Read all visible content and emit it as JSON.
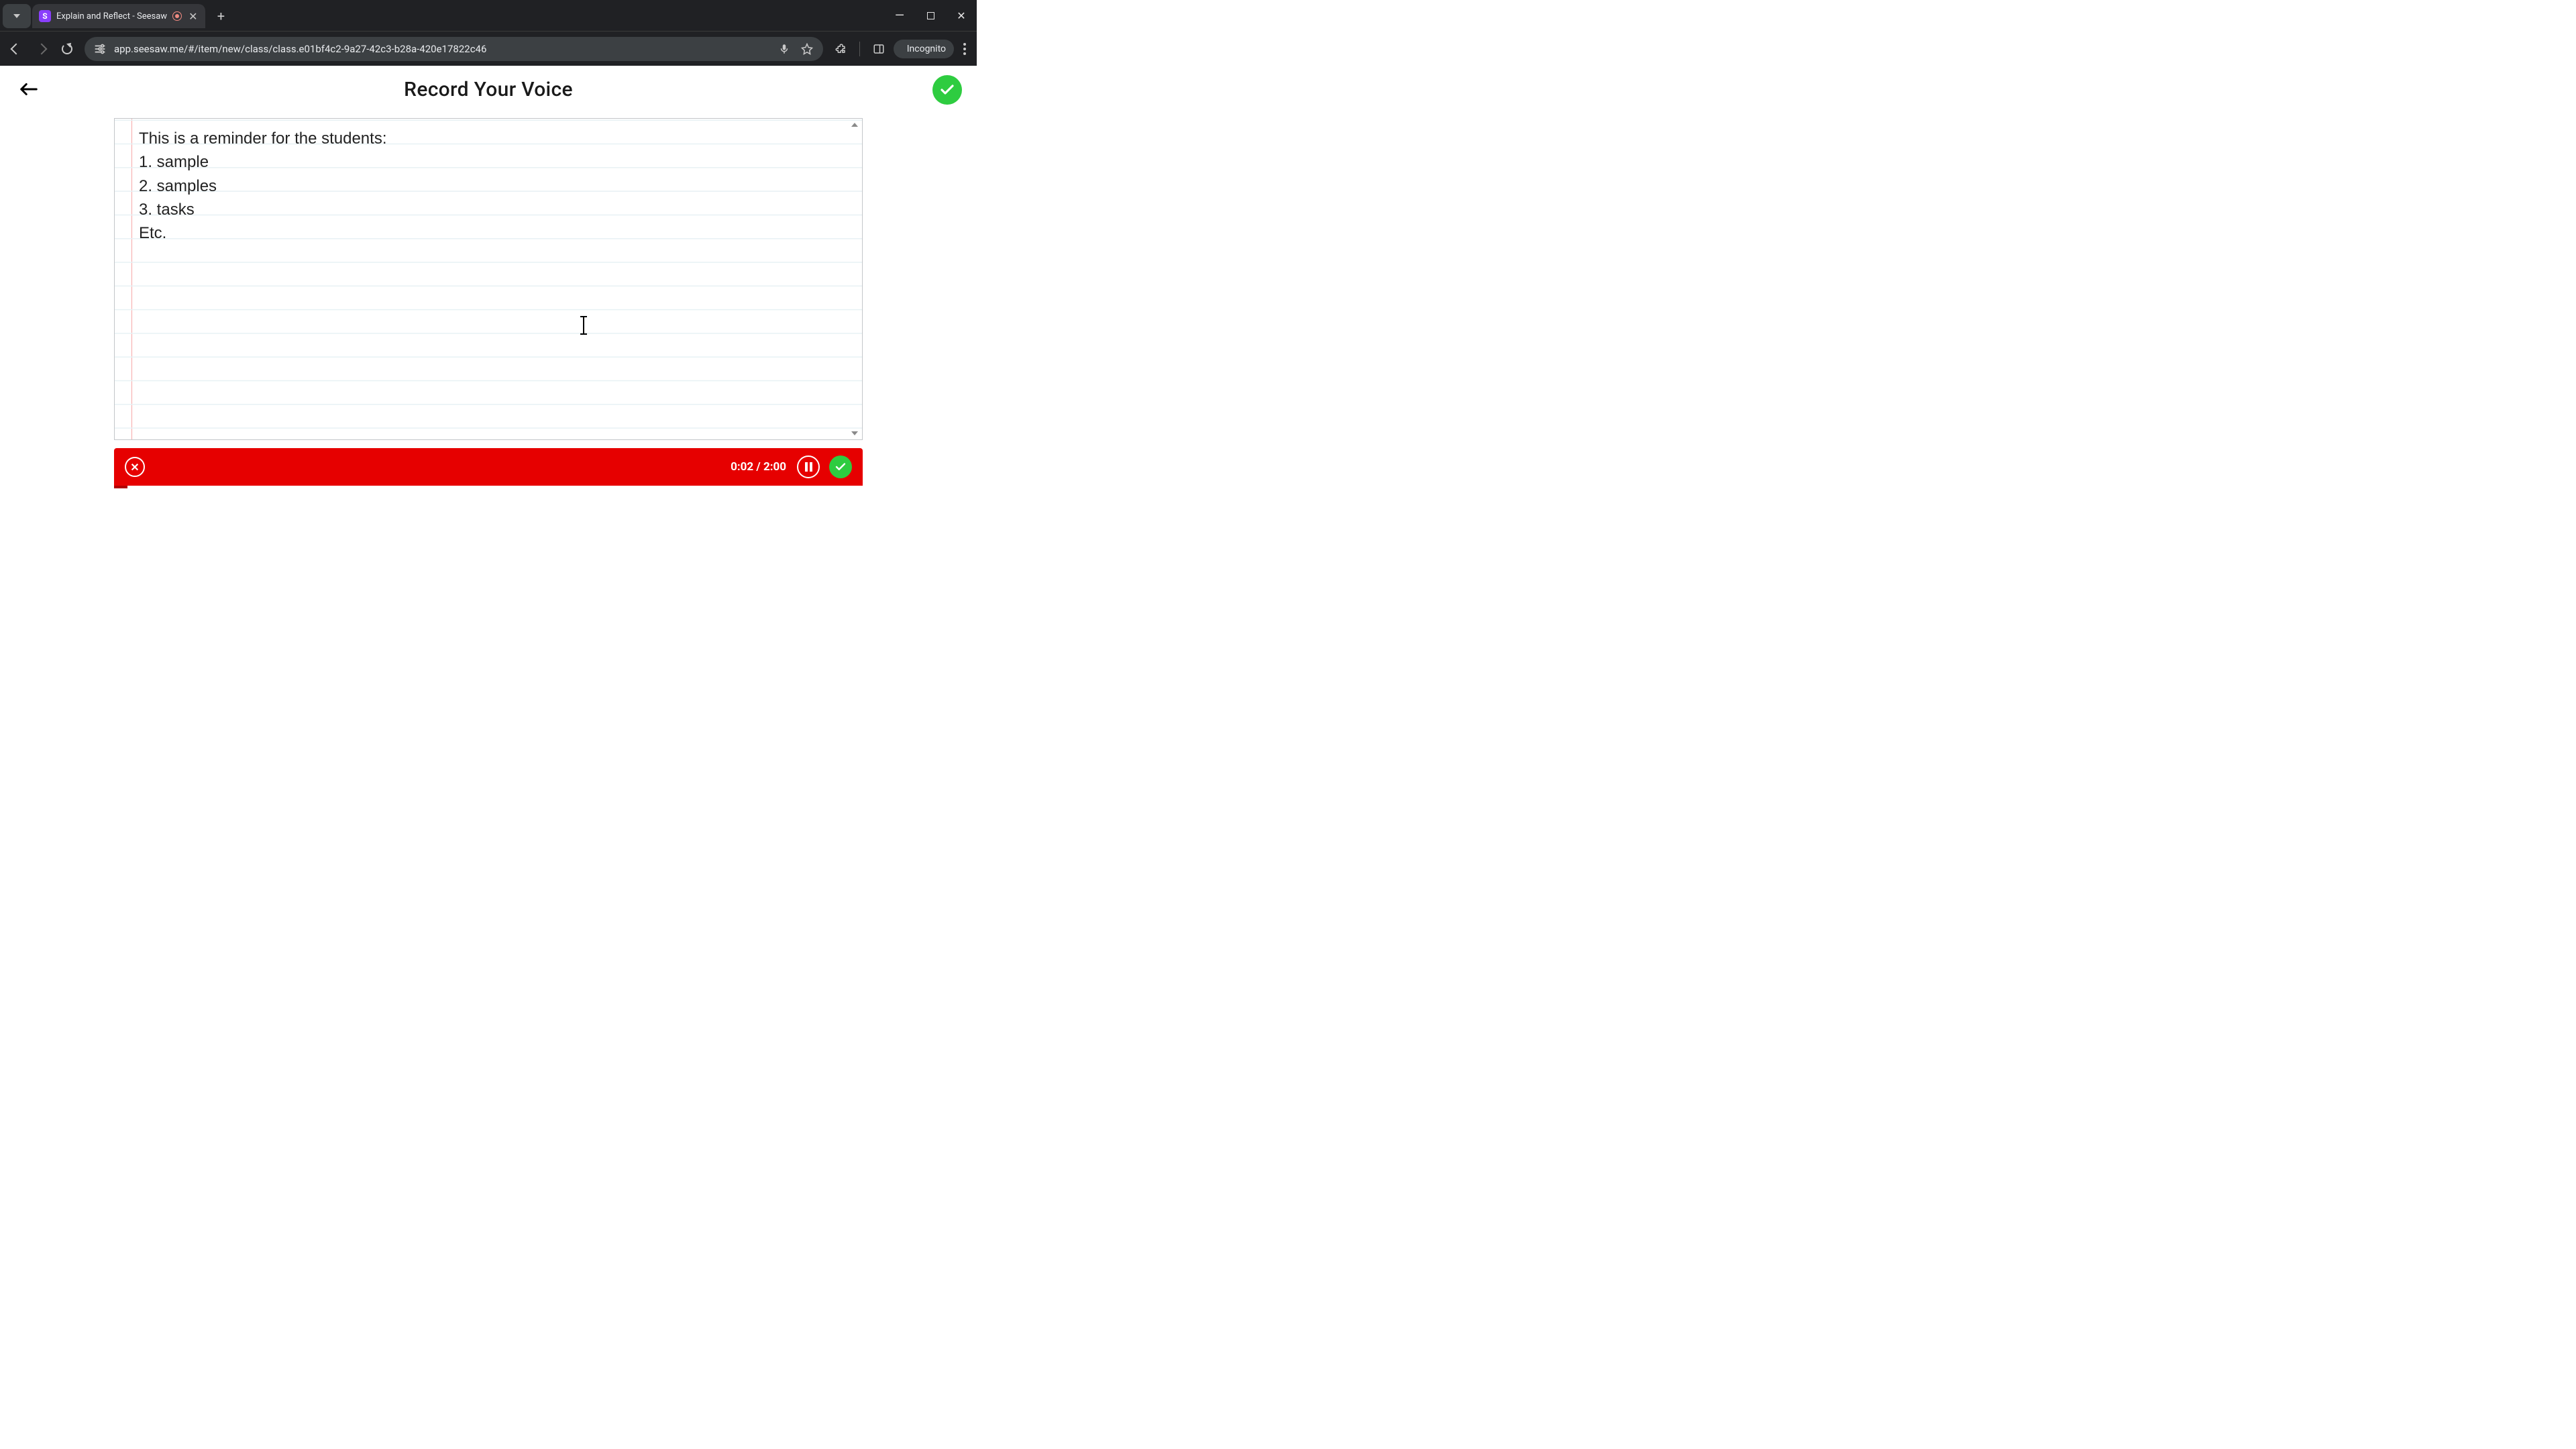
{
  "browser": {
    "tab_title": "Explain and Reflect - Seesaw",
    "url": "app.seesaw.me/#/item/new/class/class.e01bf4c2-9a27-42c3-b28a-420e17822c46",
    "incognito_label": "Incognito",
    "favicon_letter": "S"
  },
  "header": {
    "title": "Record Your Voice"
  },
  "note": {
    "lines": [
      "This is a reminder for the students:",
      "1. sample",
      "2. samples",
      "3. tasks",
      "Etc."
    ]
  },
  "recorder": {
    "elapsed": "0:02",
    "total": "2:00"
  }
}
